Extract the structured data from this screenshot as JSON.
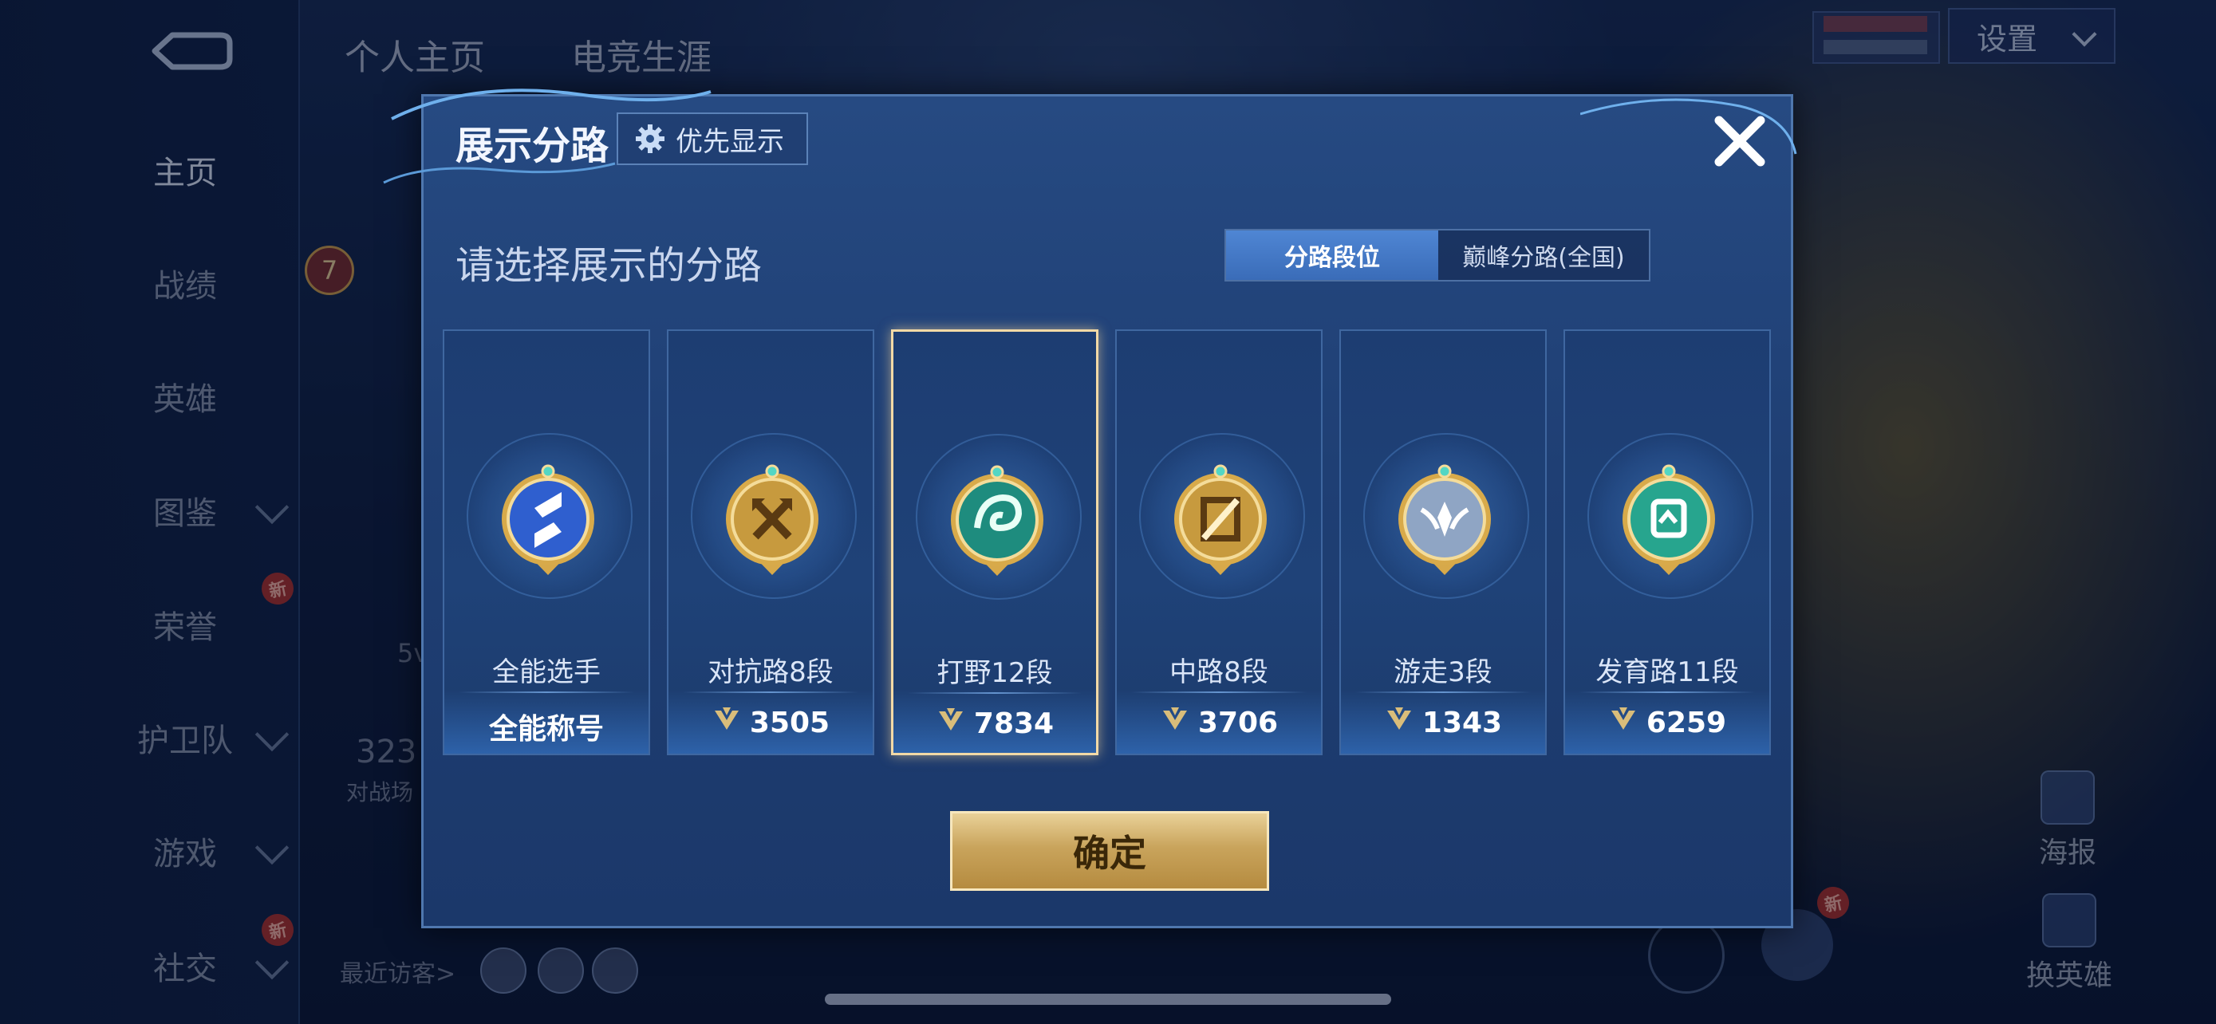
{
  "left_nav": {
    "items": [
      {
        "label": "主页",
        "active": true,
        "chevron": false,
        "badge": ""
      },
      {
        "label": "战绩",
        "active": false,
        "chevron": false,
        "badge": ""
      },
      {
        "label": "英雄",
        "active": false,
        "chevron": false,
        "badge": ""
      },
      {
        "label": "图鉴",
        "active": false,
        "chevron": true,
        "badge": ""
      },
      {
        "label": "荣誉",
        "active": false,
        "chevron": false,
        "badge": "新"
      },
      {
        "label": "护卫队",
        "active": false,
        "chevron": true,
        "badge": ""
      },
      {
        "label": "游戏",
        "active": false,
        "chevron": true,
        "badge": ""
      },
      {
        "label": "社交",
        "active": false,
        "chevron": true,
        "badge": "新"
      }
    ]
  },
  "top_tabs": [
    "个人主页",
    "电竞生涯"
  ],
  "settings_label": "设置",
  "background_profile": {
    "count_partial": "323",
    "count_caption": "对战场",
    "level": "7",
    "recent_visitors": "最近访客>",
    "short_text": "5v"
  },
  "right_tools": {
    "poster": "海报",
    "swap_hero": "换英雄",
    "new_badge": "新"
  },
  "modal": {
    "title": "展示分路",
    "priority_button": "优先显示",
    "subtitle": "请选择展示的分路",
    "toggle": {
      "options": [
        "分路段位",
        "巅峰分路(全国)"
      ],
      "active_index": 0
    },
    "cards": [
      {
        "name": "全能选手",
        "value": "全能称号",
        "has_score_icon": false,
        "emblem": "all-round-emblem-icon",
        "emblem_color": "#2f5fcf",
        "selected": false
      },
      {
        "name": "对抗路8段",
        "value": "3505",
        "has_score_icon": true,
        "emblem": "clash-lane-emblem-icon",
        "emblem_color": "#c79a3e",
        "selected": false
      },
      {
        "name": "打野12段",
        "value": "7834",
        "has_score_icon": true,
        "emblem": "jungle-emblem-icon",
        "emblem_color": "#1e8c7e",
        "selected": true
      },
      {
        "name": "中路8段",
        "value": "3706",
        "has_score_icon": true,
        "emblem": "mid-lane-emblem-icon",
        "emblem_color": "#c79a3e",
        "selected": false
      },
      {
        "name": "游走3段",
        "value": "1343",
        "has_score_icon": true,
        "emblem": "roam-emblem-icon",
        "emblem_color": "#8fa5c4",
        "selected": false
      },
      {
        "name": "发育路11段",
        "value": "6259",
        "has_score_icon": true,
        "emblem": "farm-lane-emblem-icon",
        "emblem_color": "#27a58e",
        "selected": false
      }
    ],
    "confirm_button": "确定"
  },
  "colors": {
    "accent_blue": "#3a6cb8",
    "gold": "#c9a45c",
    "selected_border": "#f2d9a6"
  }
}
